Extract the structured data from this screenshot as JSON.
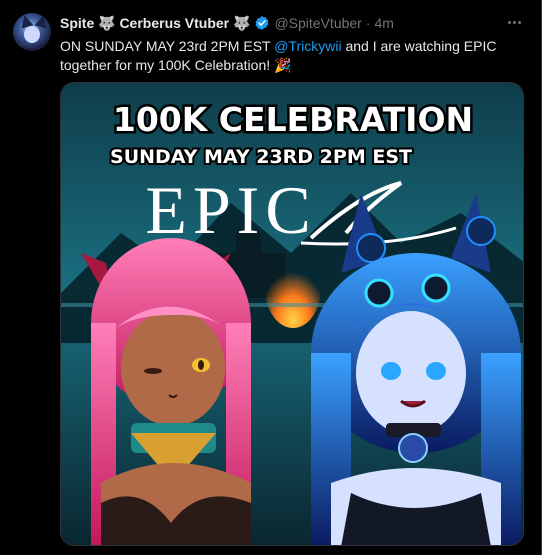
{
  "tweet": {
    "author": {
      "display_name": "Spite 🐺 Cerberus Vtuber 🐺",
      "handle": "@SpiteVtuber",
      "separator": "·",
      "time": "4m",
      "verified": true
    },
    "text": {
      "before": "ON SUNDAY MAY 23rd 2PM EST ",
      "mention": "@Trickywii",
      "after": " and I are watching EPIC together for my 100K Celebration! 🎉"
    },
    "media": {
      "headline": "100K CELEBRATION",
      "subheadline": "SUNDAY MAY 23RD 2PM EST",
      "logo": "EPIC"
    }
  },
  "colors": {
    "background": "#000000",
    "text": "#e7e9ea",
    "muted": "#71767b",
    "link": "#1d9bf0",
    "verified": "#1d9bf0"
  },
  "icons": [
    "avatar",
    "verified-badge-icon",
    "more-options-icon"
  ]
}
